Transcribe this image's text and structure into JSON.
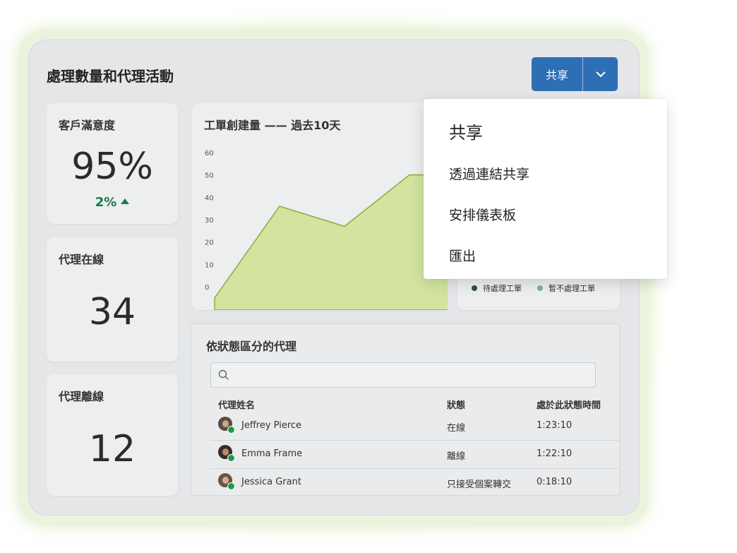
{
  "header": {
    "title": "處理數量和代理活動"
  },
  "share": {
    "label": "共享"
  },
  "dropdown": {
    "heading": "共享",
    "items": [
      "透過連結共享",
      "安排儀表板",
      "匯出"
    ]
  },
  "stats": {
    "csat": {
      "label": "客戶滿意度",
      "value": "95%",
      "delta": "2%"
    },
    "online": {
      "label": "代理在線",
      "value": "34"
    },
    "offline": {
      "label": "代理離線",
      "value": "12"
    }
  },
  "chart_title": "工單創建量 —— 過去10天",
  "chart_data": {
    "type": "area",
    "title": "工單創建量 —— 過去10天",
    "y_ticks": [
      "60",
      "50",
      "40",
      "30",
      "20",
      "10",
      "0"
    ],
    "ylim": [
      0,
      60
    ],
    "x": [
      0,
      1,
      2,
      3,
      4,
      5
    ],
    "values": [
      -5,
      36,
      27,
      50,
      50,
      50
    ],
    "grid": false
  },
  "legend": {
    "items": [
      "待處理工單",
      "暫不處理工單"
    ],
    "colors": [
      "#2f4f3f",
      "#7fb0a0"
    ]
  },
  "agents": {
    "title": "依狀態區分的代理",
    "search_placeholder": "",
    "columns": [
      "代理姓名",
      "狀態",
      "處於此狀態時間"
    ],
    "rows": [
      {
        "name": "Jeffrey Pierce",
        "status": "在線",
        "time": "1:23:10"
      },
      {
        "name": "Emma Frame",
        "status": "離線",
        "time": "1:22:10"
      },
      {
        "name": "Jessica Grant",
        "status": "只接受個案轉交",
        "time": "0:18:10"
      }
    ]
  },
  "colors": {
    "accent": "#2e6eb5",
    "positive": "#1f7a47",
    "area_fill": "#d3e49f",
    "area_line": "#8aab3c",
    "online": "#1f9a4a"
  }
}
